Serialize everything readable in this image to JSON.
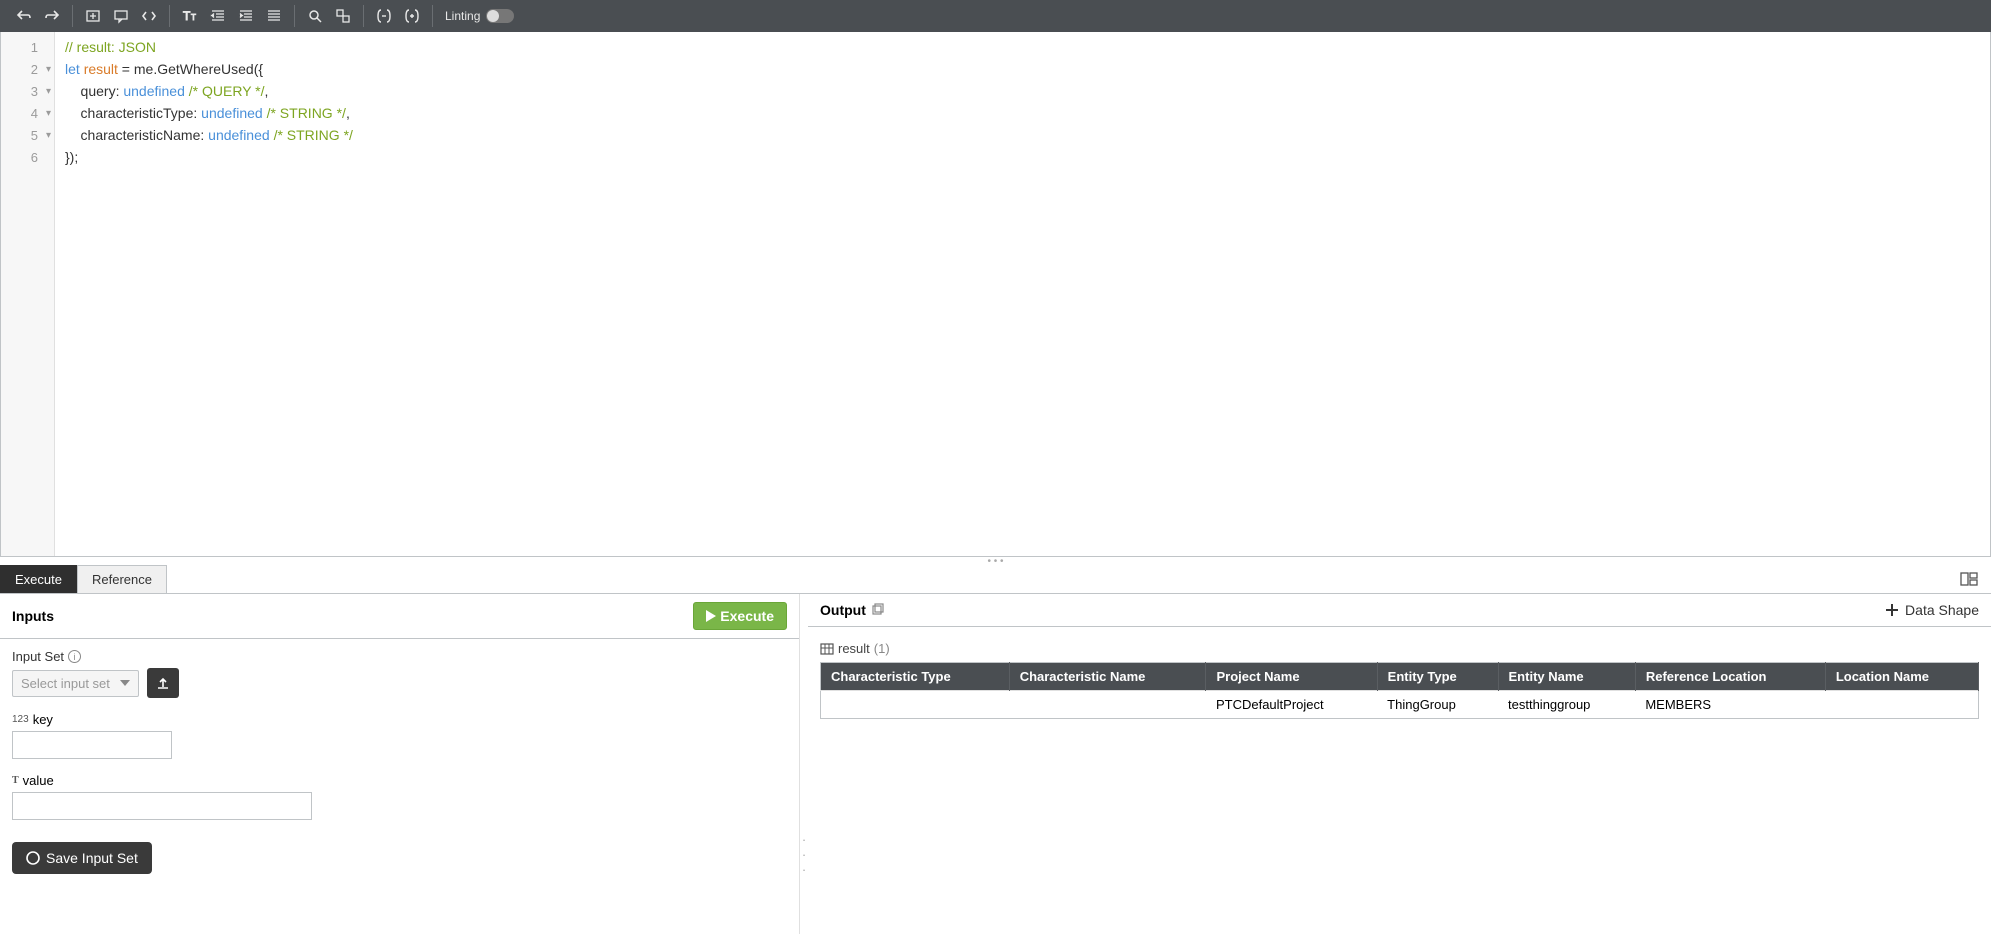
{
  "toolbar": {
    "linting_label": "Linting"
  },
  "code": {
    "lines": [
      {
        "n": "1",
        "fold": false,
        "segments": [
          {
            "cls": "c-comment",
            "t": "// result: JSON"
          }
        ]
      },
      {
        "n": "2",
        "fold": true,
        "segments": [
          {
            "cls": "c-key",
            "t": "let"
          },
          {
            "cls": "c-text",
            "t": " "
          },
          {
            "cls": "c-ident",
            "t": "result"
          },
          {
            "cls": "c-text",
            "t": " = me.GetWhereUsed({"
          }
        ]
      },
      {
        "n": "3",
        "fold": true,
        "segments": [
          {
            "cls": "c-text",
            "t": "    query: "
          },
          {
            "cls": "c-val",
            "t": "undefined"
          },
          {
            "cls": "c-text",
            "t": " "
          },
          {
            "cls": "c-comment",
            "t": "/* QUERY */"
          },
          {
            "cls": "c-text",
            "t": ","
          }
        ]
      },
      {
        "n": "4",
        "fold": true,
        "segments": [
          {
            "cls": "c-text",
            "t": "    characteristicType: "
          },
          {
            "cls": "c-val",
            "t": "undefined"
          },
          {
            "cls": "c-text",
            "t": " "
          },
          {
            "cls": "c-comment",
            "t": "/* STRING */"
          },
          {
            "cls": "c-text",
            "t": ","
          }
        ]
      },
      {
        "n": "5",
        "fold": true,
        "segments": [
          {
            "cls": "c-text",
            "t": "    characteristicName: "
          },
          {
            "cls": "c-val",
            "t": "undefined"
          },
          {
            "cls": "c-text",
            "t": " "
          },
          {
            "cls": "c-comment",
            "t": "/* STRING */"
          }
        ]
      },
      {
        "n": "6",
        "fold": false,
        "segments": [
          {
            "cls": "c-text",
            "t": "});"
          }
        ]
      }
    ]
  },
  "tabs": {
    "execute": "Execute",
    "reference": "Reference"
  },
  "inputs": {
    "panel_title": "Inputs",
    "execute_btn": "Execute",
    "input_set_label": "Input Set",
    "select_placeholder": "Select input set",
    "key_prefix": "123",
    "key_label": "key",
    "value_prefix": "T",
    "value_label": "value",
    "key_value": "",
    "value_value": "",
    "save_btn": "Save Input Set"
  },
  "output": {
    "panel_title": "Output",
    "data_shape_btn": "Data Shape",
    "result_label": "result",
    "result_count": "(1)",
    "columns": [
      "Characteristic Type",
      "Characteristic Name",
      "Project Name",
      "Entity Type",
      "Entity Name",
      "Reference Location",
      "Location Name"
    ],
    "rows": [
      {
        "characteristic_type": "",
        "characteristic_name": "",
        "project_name": "PTCDefaultProject",
        "entity_type": "ThingGroup",
        "entity_name": "testthinggroup",
        "reference_location": "MEMBERS",
        "location_name": ""
      }
    ]
  }
}
